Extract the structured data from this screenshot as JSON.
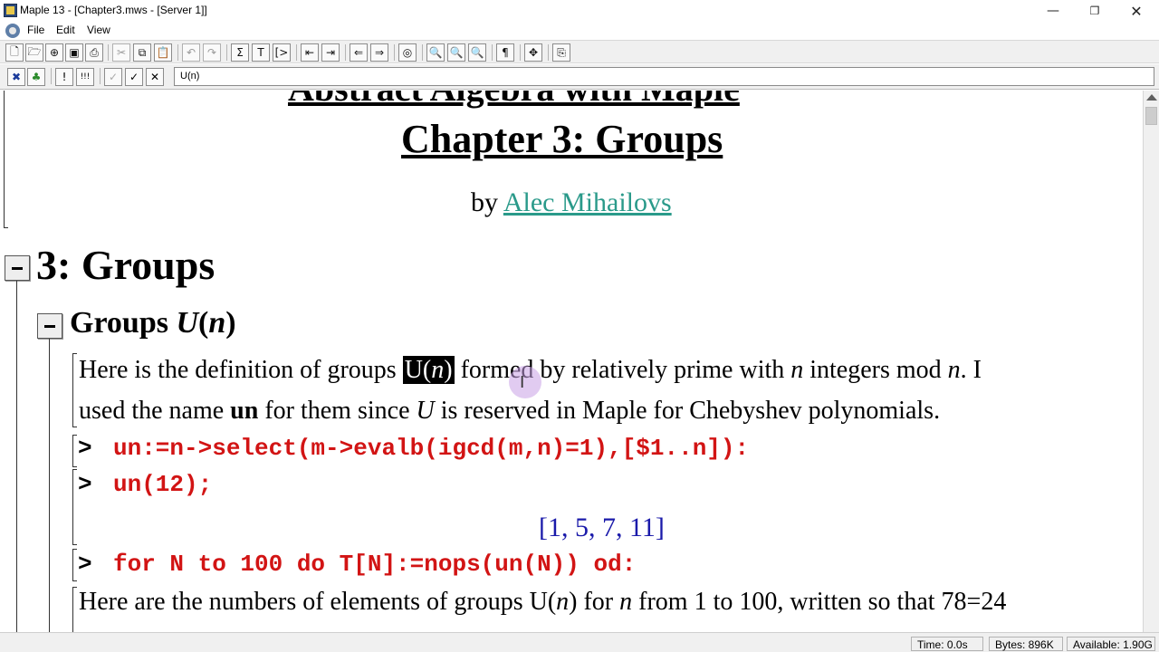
{
  "window": {
    "title": "Maple 13  - [Chapter3.mws - [Server 1]]",
    "controls": {
      "minimize": "—",
      "maximize": "❐",
      "close": "✕"
    }
  },
  "menu": {
    "file": "File",
    "edit": "Edit",
    "view": "View"
  },
  "toolbar": {
    "buttons": [
      {
        "name": "new-icon",
        "glyph": "🗋"
      },
      {
        "name": "open-icon",
        "glyph": "🗁"
      },
      {
        "name": "open-url-icon",
        "glyph": "⊕"
      },
      {
        "name": "save-icon",
        "glyph": "▣"
      },
      {
        "name": "print-icon",
        "glyph": "⎙"
      },
      {
        "name": "cut-icon",
        "glyph": "✂"
      },
      {
        "name": "copy-icon",
        "glyph": "⧉"
      },
      {
        "name": "paste-icon",
        "glyph": "📋"
      },
      {
        "name": "undo-icon",
        "glyph": "↶"
      },
      {
        "name": "redo-icon",
        "glyph": "↷"
      },
      {
        "name": "insert-math-icon",
        "glyph": "Σ"
      },
      {
        "name": "insert-text-icon",
        "glyph": "T"
      },
      {
        "name": "insert-prompt-icon",
        "glyph": "[>"
      },
      {
        "name": "outdent-icon",
        "glyph": "⇤"
      },
      {
        "name": "indent-icon",
        "glyph": "⇥"
      },
      {
        "name": "back-icon",
        "glyph": "⇐"
      },
      {
        "name": "forward-icon",
        "glyph": "⇒"
      },
      {
        "name": "stop-icon",
        "glyph": "◎"
      },
      {
        "name": "zoom-100-icon",
        "glyph": "🔍"
      },
      {
        "name": "zoom-150-icon",
        "glyph": "🔍"
      },
      {
        "name": "zoom-200-icon",
        "glyph": "🔍"
      },
      {
        "name": "show-markers-icon",
        "glyph": "¶"
      },
      {
        "name": "expand-sections-icon",
        "glyph": "✥"
      },
      {
        "name": "restart-icon",
        "glyph": "⎘"
      }
    ]
  },
  "context_bar": {
    "buttons": [
      {
        "name": "text-mode-icon",
        "glyph": "✖"
      },
      {
        "name": "maple-input-icon",
        "glyph": "♣"
      },
      {
        "name": "execute-icon",
        "glyph": "!"
      },
      {
        "name": "execute-all-icon",
        "glyph": "!!!"
      },
      {
        "name": "cancel-icon",
        "glyph": "✓"
      },
      {
        "name": "accept-icon",
        "glyph": "✓"
      },
      {
        "name": "reject-icon",
        "glyph": "✕"
      }
    ],
    "input_value": "U(n)"
  },
  "document": {
    "cut_title": "Abstract Algebra with Maple",
    "chapter_title": "Chapter 3: Groups",
    "byline_prefix": "by ",
    "author": "Alec Mihailovs",
    "section_title": "3: Groups",
    "subsection_title_text": "Groups ",
    "subsection_title_var": "U",
    "subsection_title_paren_open": "(",
    "subsection_title_n": "n",
    "subsection_title_paren_close": ")",
    "para1_a": "Here is the definition of groups ",
    "para1_hl_U": "U(",
    "para1_hl_n": "n",
    "para1_hl_close": ")",
    "para1_b": " formed by relatively prime with ",
    "para1_n": "n",
    "para1_c": " integers mod ",
    "para1_n2": "n",
    "para1_d": ". I",
    "para2_a": "used the name ",
    "para2_bold": "un",
    "para2_b": " for them since ",
    "para2_U": "U",
    "para2_c": " is reserved in Maple for Chebyshev polynomials.",
    "prompt": ">",
    "command_1": "un:=n->select(m->evalb(igcd(m,n)=1),[$1..n]):",
    "command_2": "un(12);",
    "output_1": "[1, 5, 7, 11]",
    "command_3": "for N to 100 do T[N]:=nops(un(N)) od:",
    "para3_a": "Here are the numbers of elements of groups U(",
    "para3_n": "n",
    "para3_b": ") for ",
    "para3_n2": "n",
    "para3_c": " from 1 to 100, written so that 78=24"
  },
  "status": {
    "time": "Time:  0.0s",
    "bytes": "Bytes:  896K",
    "available": "Available:  1.90G"
  }
}
